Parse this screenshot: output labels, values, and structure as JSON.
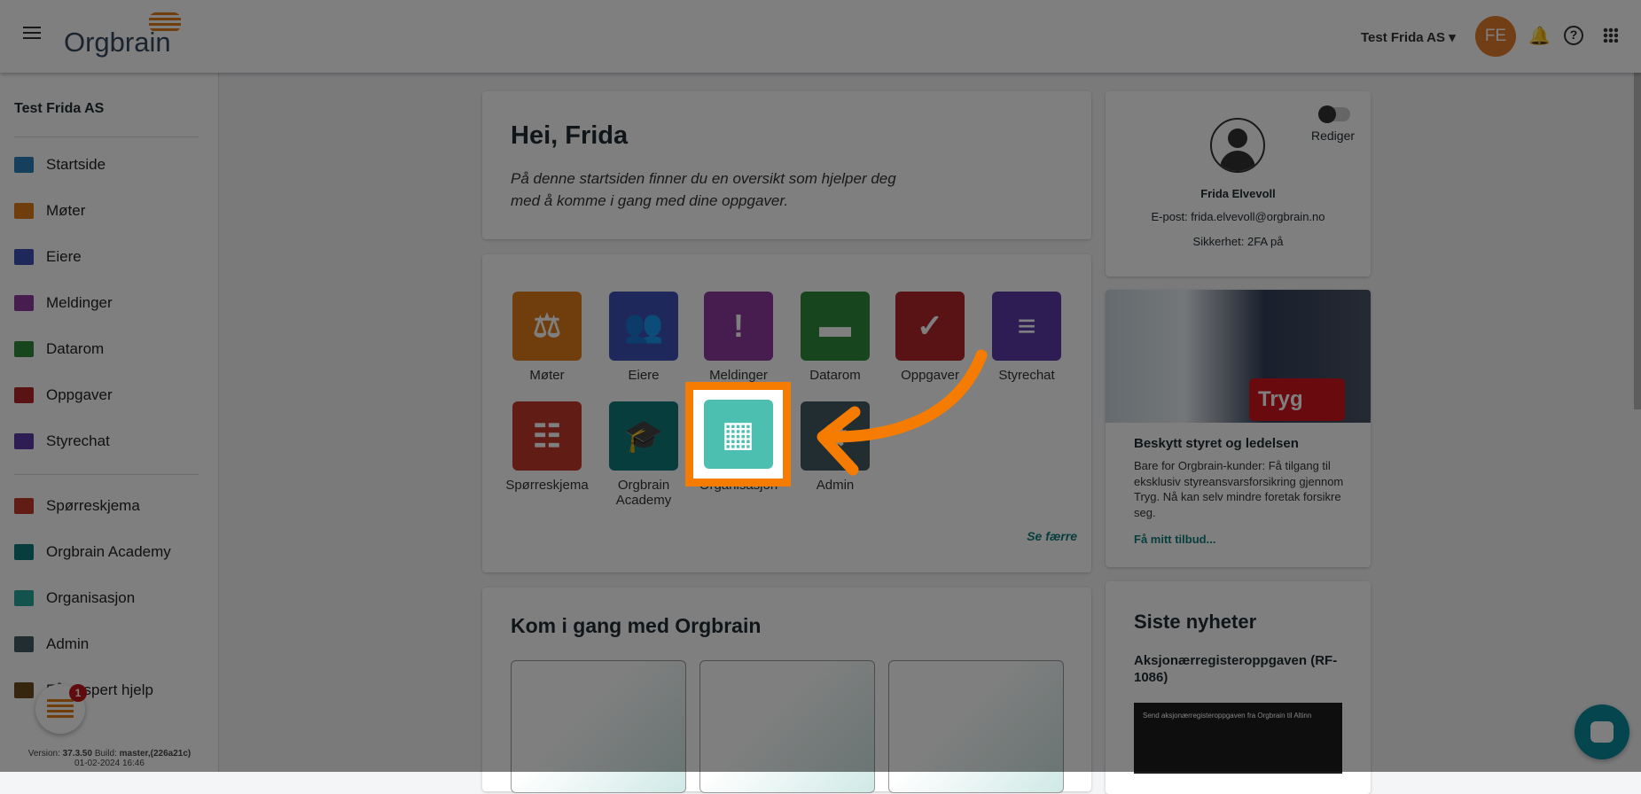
{
  "header": {
    "logo": "Orgbrain",
    "org_selector": "Test Frida AS",
    "avatar_initials": "FE"
  },
  "sidebar": {
    "org_name": "Test Frida AS",
    "items": [
      {
        "label": "Startside",
        "color": "#2a7fb8"
      },
      {
        "label": "Møter",
        "color": "#e07b1a"
      },
      {
        "label": "Eiere",
        "color": "#3f51b5"
      },
      {
        "label": "Meldinger",
        "color": "#8e3b9e"
      },
      {
        "label": "Datarom",
        "color": "#2e8b3a"
      },
      {
        "label": "Oppgaver",
        "color": "#b3262b"
      },
      {
        "label": "Styrechat",
        "color": "#5a3aa8"
      }
    ],
    "items2": [
      {
        "label": "Spørreskjema",
        "color": "#c0392b"
      },
      {
        "label": "Orgbrain Academy",
        "color": "#117a7a"
      },
      {
        "label": "Organisasjon",
        "color": "#26a69a"
      },
      {
        "label": "Admin",
        "color": "#455a64"
      },
      {
        "label": "Få ekspert hjelp",
        "visible_label": "Få ekspert hjelp",
        "color": "#6d4c1f"
      }
    ],
    "chat_badge": "1",
    "version_label": "Version:",
    "version": "37.3.50",
    "build_label": "Build:",
    "build": "master,(226a21c)",
    "date": "01-02-2024 16:46"
  },
  "welcome": {
    "title": "Hei, Frida",
    "text": "På denne startsiden finner du en oversikt som hjelper deg med å komme i gang med dine oppgaver."
  },
  "apps": {
    "tiles": [
      {
        "label": "Møter",
        "color": "#e07b1a",
        "glyph": "⚖"
      },
      {
        "label": "Eiere",
        "color": "#3f51b5",
        "glyph": "👥"
      },
      {
        "label": "Meldinger",
        "color": "#8e3b9e",
        "glyph": "!"
      },
      {
        "label": "Datarom",
        "color": "#2e8b3a",
        "glyph": "▬"
      },
      {
        "label": "Oppgaver",
        "color": "#b3262b",
        "glyph": "✓"
      },
      {
        "label": "Styrechat",
        "color": "#5a3aa8",
        "glyph": "≡"
      },
      {
        "label": "Spørreskjema",
        "color": "#c0392b",
        "glyph": "☷"
      },
      {
        "label": "Orgbrain Academy",
        "color": "#117a7a",
        "glyph": "🎓"
      },
      {
        "label": "Organisasjon",
        "color": "#4dbfb0",
        "glyph": "▦"
      },
      {
        "label": "Admin",
        "color": "#455a64",
        "glyph": "⚙"
      }
    ],
    "see_less": "Se færre"
  },
  "getting_started": {
    "title": "Kom i gang med Orgbrain"
  },
  "profile": {
    "toggle_label": "Rediger",
    "name": "Frida Elvevoll",
    "email": "E-post: frida.elvevoll@orgbrain.no",
    "security": "Sikkerhet: 2FA på"
  },
  "promo": {
    "badge": "Tryg",
    "title": "Beskytt styret og ledelsen",
    "text": "Bare for Orgbrain-kunder: Få tilgang til eksklusiv styreansvarsforsikring gjennom Tryg. Nå kan selv mindre foretak forsikre seg.",
    "link": "Få mitt tilbud..."
  },
  "news": {
    "title": "Siste nyheter",
    "item_title": "Aksjonærregisteroppgaven (RF-1086)",
    "image_caption": "Send aksjonærregisteroppgaven fra Orgbrain til Altinn"
  },
  "accent": "#f57c00"
}
